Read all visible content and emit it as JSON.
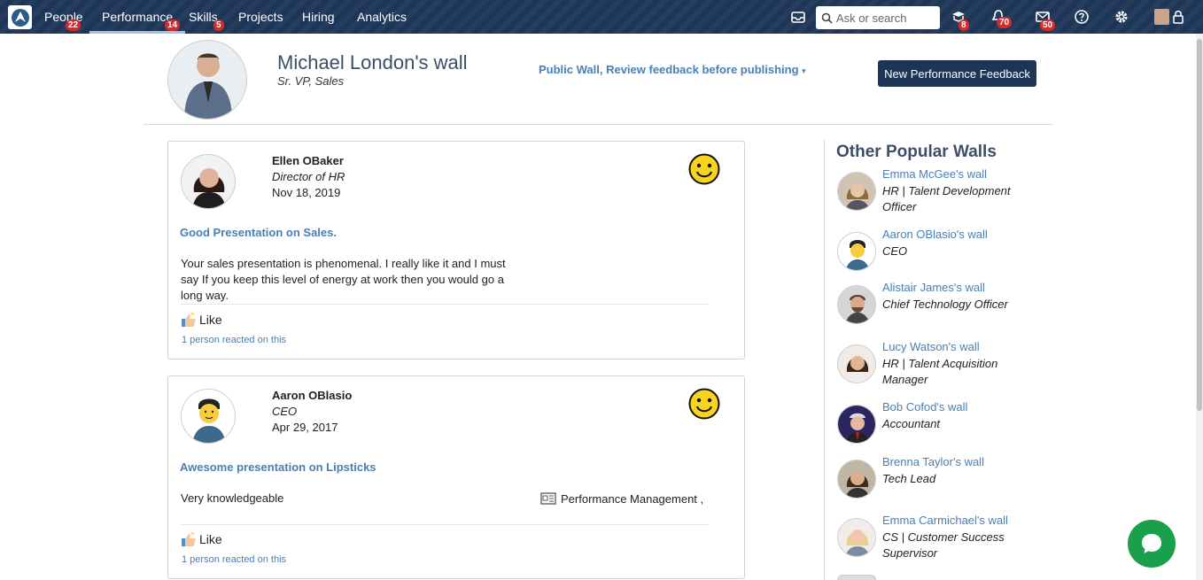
{
  "nav": {
    "items": [
      {
        "label": "People",
        "badge": "22"
      },
      {
        "label": "Performance",
        "badge": "14",
        "active": true
      },
      {
        "label": "Skills",
        "badge": "5"
      },
      {
        "label": "Projects"
      },
      {
        "label": "Hiring"
      },
      {
        "label": "Analytics"
      }
    ],
    "search_placeholder": "Ask or search",
    "badges": {
      "learning": "8",
      "notifications": "70",
      "messages": "50"
    }
  },
  "wall": {
    "title": "Michael London's wall",
    "subtitle": "Sr. VP, Sales",
    "mode": "Public Wall, Review feedback before publishing",
    "new_feedback_button": "New Performance Feedback"
  },
  "feedback": [
    {
      "name": "Ellen OBaker",
      "role": "Director of HR",
      "date": "Nov 18, 2019",
      "topic": "Good Presentation on Sales.",
      "body": "Your sales presentation is phenomenal. I really like it and I must say If you keep this level of energy at work then you would go a long way.",
      "like_label": "Like",
      "reactions": "1 person reacted on this"
    },
    {
      "name": "Aaron OBlasio",
      "role": "CEO",
      "date": "Apr 29, 2017",
      "topic": "Awesome presentation on Lipsticks",
      "body": "Very knowledgeable",
      "skill": "Performance Management ,",
      "like_label": "Like",
      "reactions": "1 person reacted on this"
    }
  ],
  "sidebar": {
    "title": "Other Popular Walls",
    "walls": [
      {
        "link": "Emma McGee's wall",
        "role": "HR | Talent Development Officer"
      },
      {
        "link": "Aaron OBlasio's wall",
        "role": "CEO"
      },
      {
        "link": "Alistair James's wall",
        "role": "Chief Technology Officer"
      },
      {
        "link": "Lucy Watson's wall",
        "role": "HR | Talent Acquisition Manager"
      },
      {
        "link": "Bob Cofod's wall",
        "role": "Accountant"
      },
      {
        "link": "Brenna Taylor's wall",
        "role": "Tech Lead"
      },
      {
        "link": "Emma Carmichael's wall",
        "role": "CS | Customer Success Supervisor"
      }
    ]
  },
  "colors": {
    "nav_bg": "#1d3557",
    "link": "#4a7fb5",
    "badge": "#d52b2b",
    "chat": "#1aa04d"
  }
}
